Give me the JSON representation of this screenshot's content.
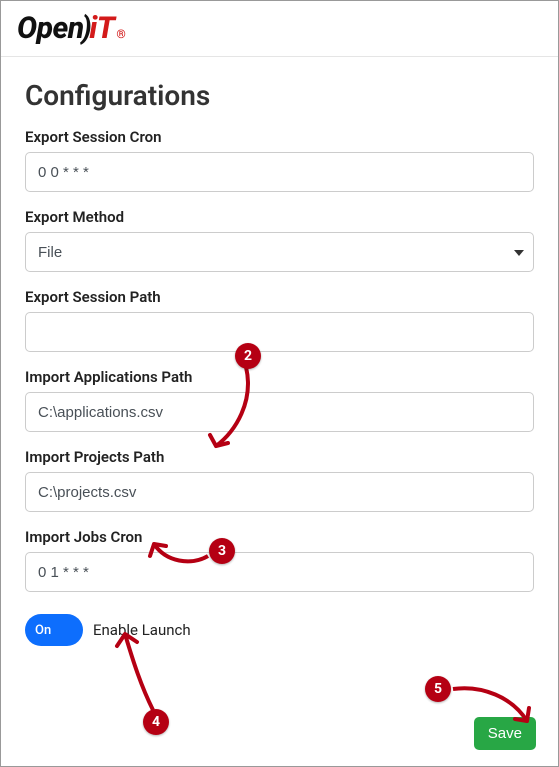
{
  "brand": {
    "open": "Open",
    "paren": ")",
    "it": "iT",
    "reg": "®"
  },
  "page": {
    "title": "Configurations"
  },
  "fields": {
    "export_session_cron": {
      "label": "Export Session Cron",
      "value": "0 0 * * *"
    },
    "export_method": {
      "label": "Export Method",
      "value": "File"
    },
    "export_session_path": {
      "label": "Export Session Path",
      "value": ""
    },
    "import_applications_path": {
      "label": "Import Applications Path",
      "value": "C:\\applications.csv"
    },
    "import_projects_path": {
      "label": "Import Projects Path",
      "value": "C:\\projects.csv"
    },
    "import_jobs_cron": {
      "label": "Import Jobs Cron",
      "value": "0 1 * * *"
    }
  },
  "toggle": {
    "state": "On",
    "label": "Enable Launch"
  },
  "buttons": {
    "save": "Save"
  },
  "annotations": {
    "n2": "2",
    "n3": "3",
    "n4": "4",
    "n5": "5"
  }
}
